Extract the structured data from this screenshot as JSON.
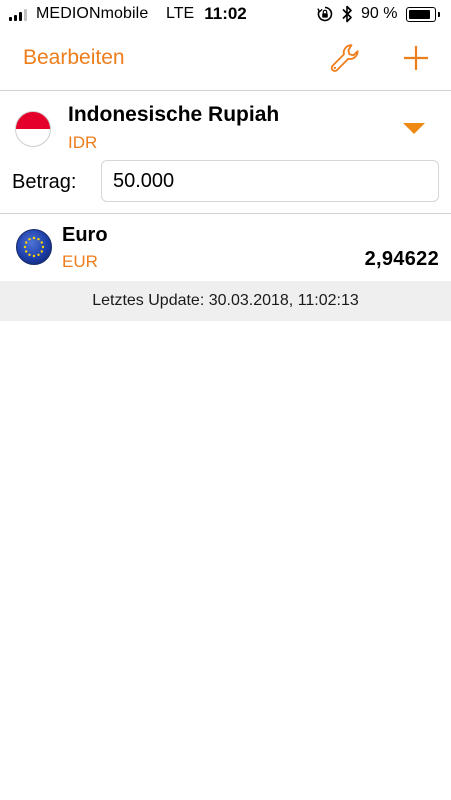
{
  "status_bar": {
    "carrier": "MEDIONmobile",
    "network": "LTE",
    "time": "11:02",
    "battery_percent": "90 %",
    "signal_bars_filled": 3,
    "signal_bars_total": 4,
    "battery_level": 0.9
  },
  "nav": {
    "edit_label": "Bearbeiten",
    "wrench_icon": "wrench-icon",
    "add_icon": "plus-icon",
    "accent_color": "#ee7d1c"
  },
  "source": {
    "name": "Indonesische Rupiah",
    "code": "IDR",
    "flag_icon": "indonesia-flag-icon",
    "amount_label": "Betrag:",
    "amount_value": "50.000"
  },
  "targets": [
    {
      "name": "Euro",
      "code": "EUR",
      "value": "2,94622",
      "flag_icon": "eu-flag-icon"
    }
  ],
  "update": {
    "text": "Letztes Update: 30.03.2018, 11:02:13"
  }
}
